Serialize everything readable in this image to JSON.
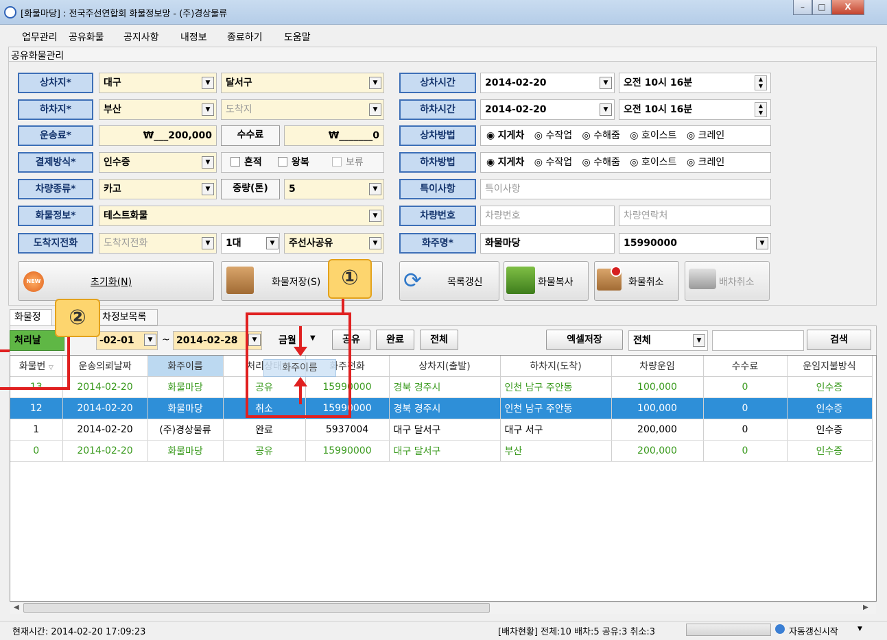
{
  "window": {
    "title": "[화물마당] : 전국주선연합회 화물정보망 - (주)경상물류",
    "min": "–",
    "max": "□",
    "close": "X"
  },
  "menu": [
    "업무관리",
    "공유화물",
    "공지사항",
    "내정보",
    "종료하기",
    "도움말"
  ],
  "panel_title": "공유화물관리",
  "form": {
    "load_place_label": "상차지*",
    "load_city": "대구",
    "load_district": "달서구",
    "unload_place_label": "하차지*",
    "unload_city": "부산",
    "unload_district_ph": "도착지",
    "fare_label": "운송료*",
    "fare_value": "₩___200,000",
    "fee_label": "수수료",
    "fee_value": "₩_______0",
    "payment_label": "결제방식*",
    "payment_value": "인수증",
    "mixed": "혼적",
    "roundtrip": "왕복",
    "hold": "보류",
    "vehicle_type_label": "차량종류*",
    "vehicle_type_value": "카고",
    "weight_label": "중량(톤)",
    "weight_value": "5",
    "cargo_label": "화물정보*",
    "cargo_value": "테스트화물",
    "dest_phone_label": "도착지전화",
    "dest_phone_ph": "도착지전화",
    "vehicle_count": "1대",
    "share_value": "주선사공유",
    "load_time_label": "상차시간",
    "load_date": "2014-02-20",
    "load_time": "오전 10시 16분",
    "unload_time_label": "하차시간",
    "unload_date": "2014-02-20",
    "unload_time": "오전 10시 16분",
    "load_method_label": "상차방법",
    "unload_method_label": "하차방법",
    "methods": [
      "지게차",
      "수작업",
      "수해줌",
      "호이스트",
      "크레인"
    ],
    "notes_label": "특이사항",
    "notes_ph": "특이사항",
    "vehicle_no_label": "차량번호",
    "vehicle_no_ph": "차량번호",
    "vehicle_contact_ph": "차량연락처",
    "shipper_label": "화주명*",
    "shipper_value": "화물마당",
    "shipper_phone": "15990000"
  },
  "buttons": {
    "reset": "초기화(N)",
    "save": "화물저장(S)",
    "refresh": "목록갱신",
    "copy": "화물복사",
    "cancel": "화물취소",
    "dispatch_cancel": "배차취소",
    "new_badge": "NEW"
  },
  "tabs": [
    "화물정",
    "차정보목록"
  ],
  "toolbar": {
    "date_label": "처리날",
    "from_date": "-02-01",
    "to_date": "2014-02-28",
    "amount": "금월",
    "share": "공유",
    "done": "완료",
    "all": "전체",
    "excel": "엑셀저장",
    "filter": "전체",
    "search": "검색"
  },
  "grid": {
    "headers": [
      "화물번",
      "운송의뢰날짜",
      "화주이름",
      "처리상태",
      "화주전화",
      "상차지(출발)",
      "하차지(도착)",
      "차량운임",
      "수수료",
      "운임지불방식"
    ],
    "rows": [
      {
        "no": "13",
        "date": "2014-02-20",
        "shipper": "화물마당",
        "status": "공유",
        "phone": "15990000",
        "from": "경북 경주시",
        "to": "인천 남구 주안동",
        "fare": "100,000",
        "fee": "0",
        "pay": "인수증"
      },
      {
        "no": "12",
        "date": "2014-02-20",
        "shipper": "화물마당",
        "status": "취소",
        "phone": "15990000",
        "from": "경북 경주시",
        "to": "인천 남구 주안동",
        "fare": "100,000",
        "fee": "0",
        "pay": "인수증"
      },
      {
        "no": "1",
        "date": "2014-02-20",
        "shipper": "(주)경상물류",
        "status": "완료",
        "phone": "5937004",
        "from": "대구 달서구",
        "to": "대구 서구",
        "fare": "200,000",
        "fee": "0",
        "pay": "인수증"
      },
      {
        "no": "0",
        "date": "2014-02-20",
        "shipper": "화물마당",
        "status": "공유",
        "phone": "15990000",
        "from": "대구 달서구",
        "to": "부산",
        "fare": "200,000",
        "fee": "0",
        "pay": "인수증"
      }
    ],
    "drag_ghost": "화주이름"
  },
  "callouts": [
    "①",
    "②"
  ],
  "status": {
    "time": "현재시간: 2014-02-20 17:09:23",
    "summary": "[배차현황] 전체:10 배차:5 공유:3 취소:3",
    "auto": "자동갱신시작"
  }
}
